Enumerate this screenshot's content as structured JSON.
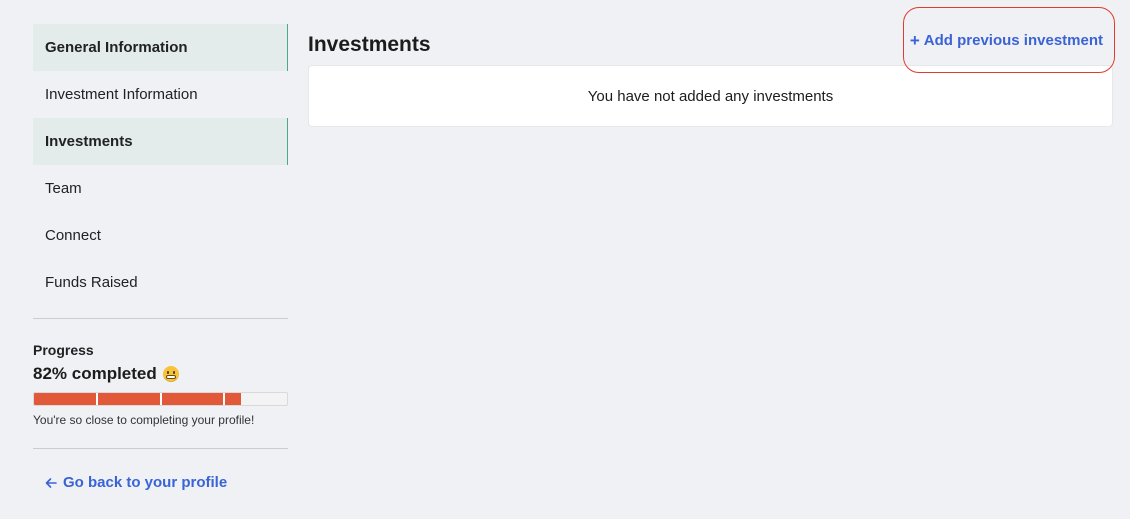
{
  "sidebar": {
    "items": [
      {
        "label": "General Information",
        "active": true
      },
      {
        "label": "Investment Information",
        "active": false
      },
      {
        "label": "Investments",
        "active": true
      },
      {
        "label": "Team",
        "active": false
      },
      {
        "label": "Connect",
        "active": false
      },
      {
        "label": "Funds Raised",
        "active": false
      }
    ],
    "progress": {
      "title": "Progress",
      "percent_label": "82% completed",
      "emoji": "grimacing-face-icon",
      "percent_value": 82,
      "segments_completed": 4,
      "hint": "You're so close to completing your profile!"
    },
    "back_link": {
      "label": "Go back to your profile",
      "icon": "arrow-left-icon"
    }
  },
  "main": {
    "title": "Investments",
    "add_button": {
      "label": "Add previous investment",
      "icon": "plus-icon"
    },
    "empty_state": "You have not added any investments"
  },
  "colors": {
    "background": "#f0f1f5",
    "active_item_bg": "#e3eceb",
    "active_item_border": "#4ea68c",
    "link": "#3a63d6",
    "progress_fill": "#e2593a",
    "highlight_ring": "#e23b2e"
  }
}
